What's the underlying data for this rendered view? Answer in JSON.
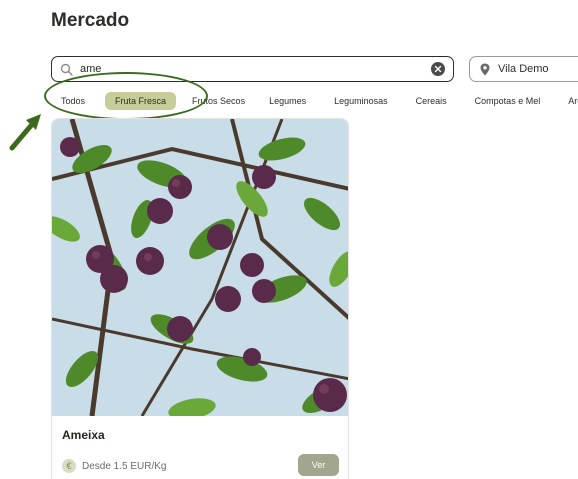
{
  "page": {
    "title": "Mercado"
  },
  "search": {
    "value": "ame",
    "icon": "search-icon",
    "clear_icon": "clear-icon"
  },
  "location": {
    "label": "Vila Demo",
    "icon": "location-pin-icon"
  },
  "categories": [
    {
      "label": "Todos",
      "active": false
    },
    {
      "label": "Fruta Fresca",
      "active": true
    },
    {
      "label": "Frutos Secos",
      "active": false
    },
    {
      "label": "Legumes",
      "active": false
    },
    {
      "label": "Leguminosas",
      "active": false
    },
    {
      "label": "Cereais",
      "active": false
    },
    {
      "label": "Compotas e Mel",
      "active": false
    },
    {
      "label": "Arom",
      "active": false
    }
  ],
  "products": [
    {
      "name": "Ameixa",
      "price": "Desde 1.5 EUR/Kg",
      "price_icon": "€",
      "action_label": "Ver"
    }
  ],
  "colors": {
    "accent": "#c8cb9a",
    "button": "#a3a68f",
    "annotation": "#3c6a1d",
    "sky": "#c9dde8",
    "leaf": "#4f8a2a",
    "plum": "#5a2a4a"
  }
}
